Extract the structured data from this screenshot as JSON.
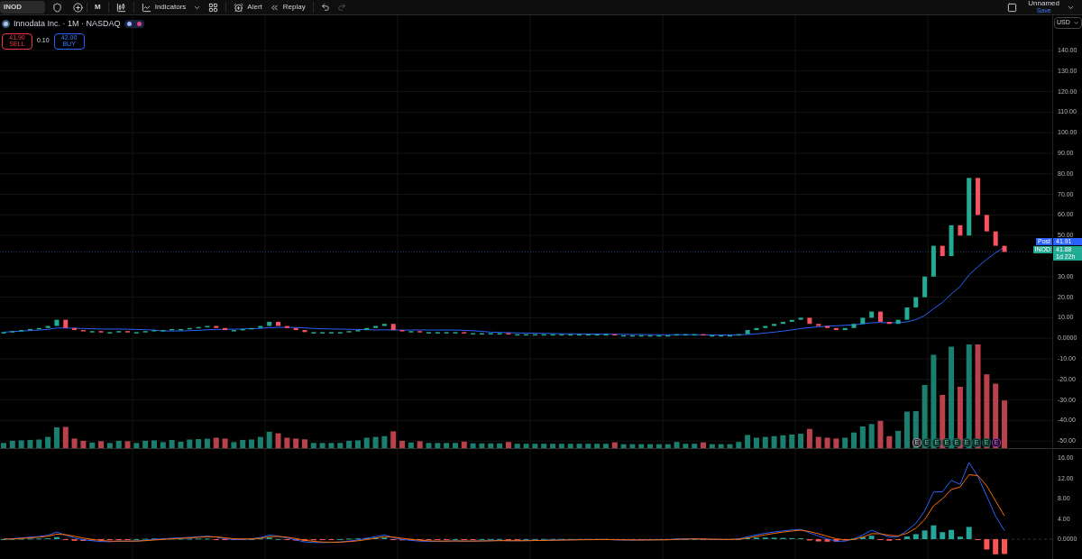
{
  "toolbar": {
    "symbol": "INOD",
    "interval": "M",
    "indicators": "Indicators",
    "alert": "Alert",
    "replay": "Replay"
  },
  "layout": {
    "name": "Unnamed",
    "save": "Save"
  },
  "legend": {
    "title": "Innodata Inc. · 1M · NASDAQ",
    "sell_price": "41.90",
    "sell_label": "SELL",
    "spread": "0.10",
    "buy_price": "42.00",
    "buy_label": "BUY"
  },
  "currency": "USD",
  "price_chart": {
    "axis_labels": [
      "140.00",
      "130.00",
      "120.00",
      "110.00",
      "100.00",
      "90.00",
      "80.00",
      "70.00",
      "60.00",
      "50.00"
    ],
    "axis_labels_lower": [
      "30.00",
      "20.00",
      "10.00",
      "0.0000",
      "-10.00",
      "-20.00",
      "-30.00",
      "-40.00",
      "-50.00"
    ],
    "post_label": {
      "tag": "Post",
      "value": "41.91"
    },
    "last_label": {
      "tag": "INOD",
      "value": "41.88",
      "countdown": "1d 22h"
    },
    "earnings": [
      {
        "label": "E",
        "kind": "past"
      },
      {
        "label": "E",
        "kind": "reported"
      },
      {
        "label": "E",
        "kind": "reported"
      },
      {
        "label": "E",
        "kind": "reported"
      },
      {
        "label": "E",
        "kind": "reported"
      },
      {
        "label": "E",
        "kind": "reported"
      },
      {
        "label": "E",
        "kind": "reported"
      },
      {
        "label": "E",
        "kind": "reported"
      },
      {
        "label": "E",
        "kind": "upcoming"
      }
    ]
  },
  "oscillator": {
    "yticks": [
      "16.00",
      "12.00",
      "8.00",
      "4.00",
      "0.0000"
    ]
  }
}
